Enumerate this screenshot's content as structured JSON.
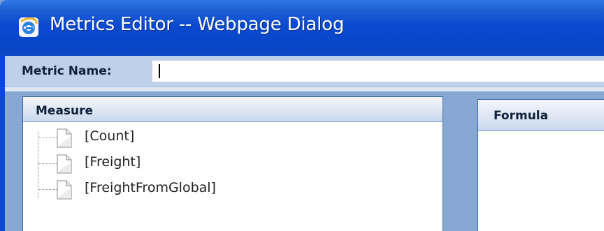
{
  "window": {
    "title": "Metrics Editor -- Webpage Dialog",
    "icon": "ie-icon"
  },
  "metric": {
    "label": "Metric Name:",
    "value": ""
  },
  "measure_panel": {
    "header": "Measure",
    "items": [
      {
        "label": "[Count]",
        "icon": "document-icon"
      },
      {
        "label": "[Freight]",
        "icon": "document-icon"
      },
      {
        "label": "[FreightFromGlobal]",
        "icon": "document-icon"
      }
    ]
  },
  "formula_panel": {
    "header": "Formula"
  },
  "colors": {
    "titlebar": "#0b4ad0",
    "metric_row": "#bfd1ea",
    "panel_frame": "#86a8d2"
  }
}
